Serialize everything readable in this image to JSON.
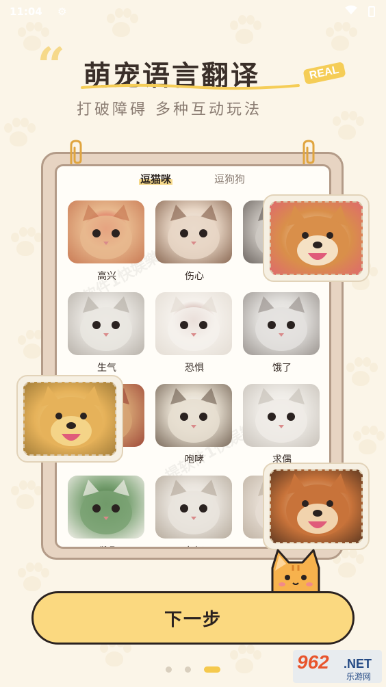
{
  "status_bar": {
    "time": "11:04",
    "gear_icon": "gear-icon",
    "wifi_icon": "wifi-icon",
    "battery_icon": "battery-icon"
  },
  "header": {
    "quote_mark": "“",
    "title": "萌宠语言翻译",
    "badge": "REAL",
    "subtitle": "打破障碍 多种互动玩法"
  },
  "tabs": [
    {
      "label": "逗猫咪",
      "active": true
    },
    {
      "label": "逗狗狗",
      "active": false
    }
  ],
  "cat_moods": [
    {
      "label": "高兴",
      "palette": [
        "#e8b98e",
        "#c97a55",
        "#d92b35"
      ]
    },
    {
      "label": "伤心",
      "palette": [
        "#e8d6c5",
        "#8b6a55",
        "#f4efe8"
      ]
    },
    {
      "label": "",
      "palette": [
        "#cfcac4",
        "#6e6762",
        "#e9e5e0"
      ]
    },
    {
      "label": "生气",
      "palette": [
        "#e9e6e1",
        "#b8b2aa",
        "#f7f4ef"
      ]
    },
    {
      "label": "恐惧",
      "palette": [
        "#f5f1ec",
        "#e4ddd4",
        "#b07b73"
      ]
    },
    {
      "label": "饿了",
      "palette": [
        "#e3e1de",
        "#9c9691",
        "#f5f3ef"
      ]
    },
    {
      "label": "",
      "palette": [
        "#d6a373",
        "#a04b3a",
        "#f0e2cf"
      ]
    },
    {
      "label": "咆哮",
      "palette": [
        "#e6ded0",
        "#7b6b5c",
        "#fafaf7"
      ]
    },
    {
      "label": "求偶",
      "palette": [
        "#eeebe6",
        "#c9c3bb",
        "#faf8f5"
      ]
    },
    {
      "label": "嘶吼",
      "palette": [
        "#7aa273",
        "#f2efe9",
        "#3c6b36"
      ]
    },
    {
      "label": "友好",
      "palette": [
        "#e9e4dd",
        "#b8ad9f",
        "#f7f4f0"
      ]
    },
    {
      "label": "",
      "palette": [
        "#e6ddd3",
        "#c0b3a4",
        "#f6f1ec"
      ]
    }
  ],
  "watermark": "提软件1快娱樂",
  "floating_dogs": [
    {
      "name": "corgi",
      "palette": [
        "#d98f4a",
        "#f5e1c4",
        "#e05b7a"
      ]
    },
    {
      "name": "shiba-hat",
      "palette": [
        "#e6b25a",
        "#f4d488",
        "#8a6a2d"
      ]
    },
    {
      "name": "shiba-smile",
      "palette": [
        "#c8733a",
        "#f1d3ad",
        "#3a2418"
      ]
    }
  ],
  "next_button": {
    "label": "下一步"
  },
  "pager": {
    "count": 3,
    "active_index": 2
  },
  "site_logo": {
    "number": "962",
    "suffix": ".NET",
    "caption": "乐游网"
  },
  "colors": {
    "accent": "#fbd980",
    "background": "#fbf5e8",
    "frame": "#e7d4c2",
    "frame_border": "#b39b88"
  }
}
